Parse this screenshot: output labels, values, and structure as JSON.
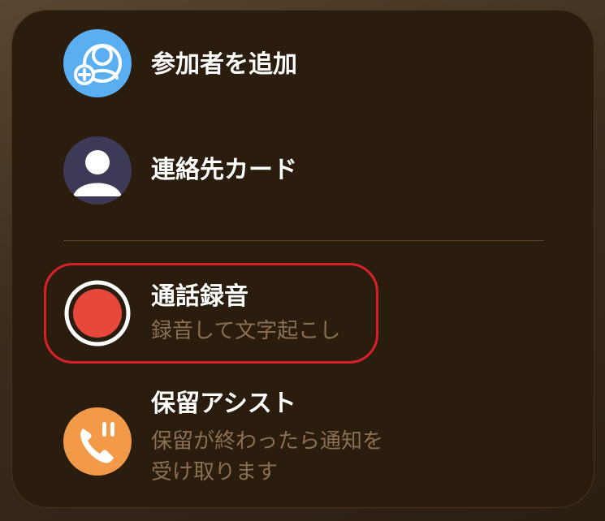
{
  "menu": {
    "items": [
      {
        "title": "参加者を追加",
        "icon": "add-participant-icon"
      },
      {
        "title": "連絡先カード",
        "icon": "contact-card-icon"
      },
      {
        "title": "通話録音",
        "subtitle": "録音して文字起こし",
        "icon": "record-icon"
      },
      {
        "title": "保留アシスト",
        "subtitle_line1": "保留が終わったら通知を",
        "subtitle_line2": "受け取ります",
        "icon": "hold-assist-icon"
      }
    ]
  },
  "colors": {
    "panel": "#2b1d0e",
    "add_icon": "#5aaef2",
    "contact_icon": "#3d3a57",
    "record_fill": "#e8473b",
    "hold_icon": "#f39a48",
    "highlight": "#d8202b",
    "subtitle": "#8a6f52"
  }
}
